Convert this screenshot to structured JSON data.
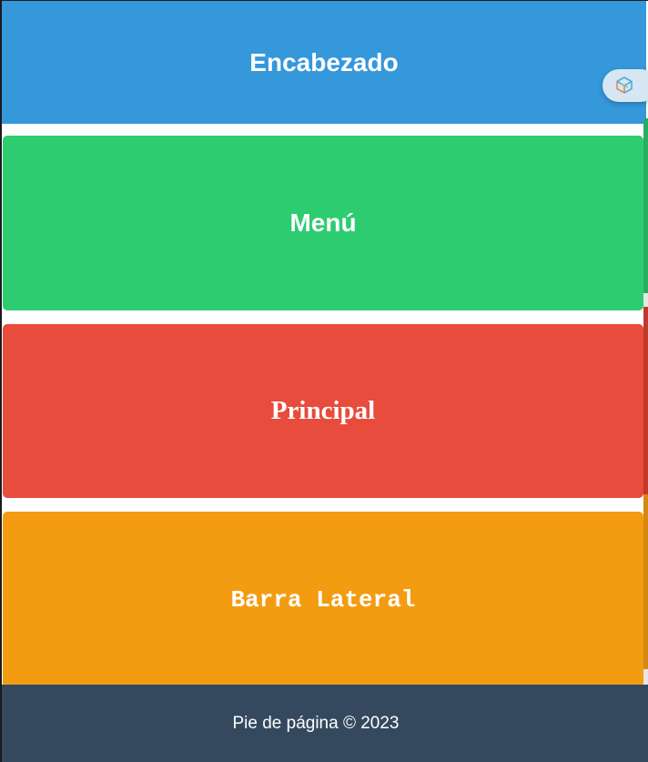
{
  "header": {
    "title": "Encabezado"
  },
  "sections": {
    "menu": {
      "label": "Menú"
    },
    "main": {
      "label": "Principal"
    },
    "sidebar": {
      "label": "Barra Lateral"
    }
  },
  "footer": {
    "text": "Pie de página © 2023"
  },
  "floating_button": {
    "icon": "cube-icon"
  },
  "colors": {
    "header": "#3498db",
    "menu": "#2ecc71",
    "main": "#e74c3c",
    "sidebar": "#f39c12",
    "footer": "#34495e"
  }
}
